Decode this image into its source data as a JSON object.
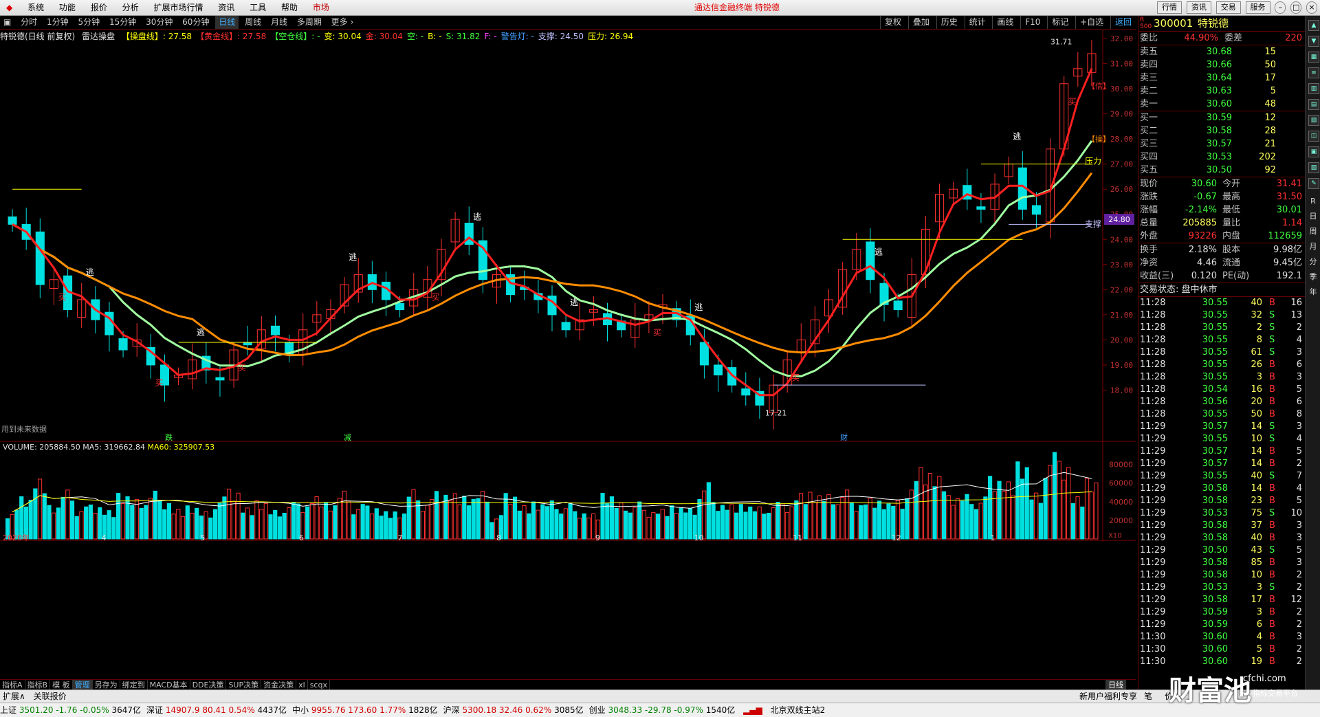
{
  "menu": {
    "items": [
      "系统",
      "功能",
      "报价",
      "分析",
      "扩展市场行情",
      "资讯",
      "工具",
      "帮助",
      "市场"
    ],
    "title": "通达信金融终端  特锐德",
    "right_buttons": [
      "行情",
      "资讯",
      "交易",
      "服务"
    ]
  },
  "period_bar": {
    "items": [
      "分时",
      "1分钟",
      "5分钟",
      "15分钟",
      "30分钟",
      "60分钟",
      "日线",
      "周线",
      "月线",
      "多周期",
      "更多 ›"
    ],
    "active": "日线",
    "right_tools": [
      "复权",
      "叠加",
      "历史",
      "统计",
      "画线",
      "F10",
      "标记",
      "+自选",
      "返回"
    ]
  },
  "indicator_line": {
    "stock": "特锐德(日线 前复权)",
    "name": "雷达操盘",
    "items": [
      {
        "label": "【操盘线】: 27.58",
        "color": "#ffff00"
      },
      {
        "label": "【黄金线】: 27.58",
        "color": "#ff3030"
      },
      {
        "label": "【空仓线】: -",
        "color": "#40ff40"
      },
      {
        "label": "变: 30.04",
        "color": "#ffff00"
      },
      {
        "label": "金: 30.04",
        "color": "#ff3030"
      },
      {
        "label": "空: -",
        "color": "#40ff40"
      },
      {
        "label": "B: -",
        "color": "#ffff00"
      },
      {
        "label": "S: 31.82",
        "color": "#40ff40"
      },
      {
        "label": "F: -",
        "color": "#ff40ff"
      },
      {
        "label": "警告灯: -",
        "color": "#40a0ff"
      },
      {
        "label": "支撑: 24.50",
        "color": "#c0c0ff"
      },
      {
        "label": "压力: 26.94",
        "color": "#ffff00"
      }
    ]
  },
  "chart_data": {
    "type": "candlestick",
    "title": "特锐德(日线 前复权)",
    "y_ticks": [
      "32.00",
      "31.00",
      "30.00",
      "29.00",
      "28.00",
      "27.00",
      "26.00",
      "25.00",
      "24.00",
      "23.00",
      "22.00",
      "21.00",
      "20.00",
      "19.00",
      "18.00"
    ],
    "price_range": [
      17.21,
      31.71
    ],
    "high_label": "31.71",
    "low_label": "17.21",
    "current_price_tag": "24.80",
    "month_labels": [
      "2020年",
      "4",
      "5",
      "6",
      "7",
      "8",
      "9",
      "10",
      "11",
      "12",
      "1"
    ],
    "bottom_markers": [
      "跌",
      "减",
      "财"
    ],
    "left_note": "用到未来数据",
    "signal_labels": {
      "buy": "买",
      "escape": "逃"
    },
    "side_labels": [
      "【信】",
      "【操】",
      "压力",
      "支撑"
    ],
    "volume": {
      "header": "VOLUME: 205884.50",
      "ma5": "MA5: 319662.84",
      "ma60": "MA60: 325907.53",
      "y_ticks": [
        "80000",
        "60000",
        "40000",
        "20000"
      ],
      "unit": "X10"
    },
    "close_series": [
      24.6,
      24.0,
      22.2,
      22.4,
      21.2,
      21.6,
      20.8,
      20.2,
      19.6,
      20.0,
      19.0,
      18.2,
      18.6,
      19.2,
      18.8,
      18.4,
      19.6,
      19.8,
      20.4,
      20.2,
      19.4,
      20.4,
      21.0,
      21.2,
      22.2,
      22.6,
      22.0,
      21.6,
      21.2,
      22.0,
      22.4,
      23.6,
      24.8,
      23.8,
      22.4,
      22.6,
      21.8,
      22.0,
      21.6,
      21.0,
      20.4,
      20.8,
      21.2,
      20.6,
      20.4,
      20.8,
      21.0,
      21.4,
      20.8,
      20.2,
      19.0,
      18.6,
      18.2,
      17.8,
      17.4,
      18.2,
      19.2,
      20.0,
      20.8,
      21.6,
      22.8,
      23.6,
      22.4,
      21.4,
      21.2,
      22.6,
      24.4,
      25.8,
      26.0,
      25.6,
      25.2,
      26.2,
      27.0,
      25.2,
      25.0,
      27.6,
      30.2,
      30.8,
      31.4
    ]
  },
  "quote": {
    "code": "300001",
    "name": "特锐德",
    "weibi": {
      "l1": "委比",
      "v1": "44.90%",
      "l2": "委差",
      "v2": "220"
    },
    "sells": [
      {
        "label": "卖五",
        "price": "30.68",
        "vol": "15"
      },
      {
        "label": "卖四",
        "price": "30.66",
        "vol": "50"
      },
      {
        "label": "卖三",
        "price": "30.64",
        "vol": "17"
      },
      {
        "label": "卖二",
        "price": "30.63",
        "vol": "5"
      },
      {
        "label": "卖一",
        "price": "30.60",
        "vol": "48"
      }
    ],
    "buys": [
      {
        "label": "买一",
        "price": "30.59",
        "vol": "12"
      },
      {
        "label": "买二",
        "price": "30.58",
        "vol": "28"
      },
      {
        "label": "买三",
        "price": "30.57",
        "vol": "21"
      },
      {
        "label": "买四",
        "price": "30.53",
        "vol": "202"
      },
      {
        "label": "买五",
        "price": "30.50",
        "vol": "92"
      }
    ],
    "stats": [
      {
        "l1": "现价",
        "v1": "30.60",
        "l2": "今开",
        "v2": "31.41",
        "c1": "#40ff40",
        "c2": "#ff3030"
      },
      {
        "l1": "涨跌",
        "v1": "-0.67",
        "l2": "最高",
        "v2": "31.50",
        "c1": "#40ff40",
        "c2": "#ff3030"
      },
      {
        "l1": "涨幅",
        "v1": "-2.14%",
        "l2": "最低",
        "v2": "30.01",
        "c1": "#40ff40",
        "c2": "#40ff40"
      },
      {
        "l1": "总量",
        "v1": "205885",
        "l2": "量比",
        "v2": "1.14",
        "c1": "#ffff60",
        "c2": "#ff3030"
      },
      {
        "l1": "外盘",
        "v1": "93226",
        "l2": "内盘",
        "v2": "112659",
        "c1": "#ff3030",
        "c2": "#40ff40"
      }
    ],
    "stats2": [
      {
        "l1": "换手",
        "v1": "2.18%",
        "l2": "股本",
        "v2": "9.98亿"
      },
      {
        "l1": "净资",
        "v1": "4.46",
        "l2": "流通",
        "v2": "9.45亿"
      },
      {
        "l1": "收益(三)",
        "v1": "0.120",
        "l2": "PE(动)",
        "v2": "192.1"
      }
    ],
    "trade_status": "交易状态: 盘中休市",
    "ticks": [
      {
        "t": "11:28",
        "p": "30.55",
        "v": "40",
        "d": "B",
        "n": "16"
      },
      {
        "t": "11:28",
        "p": "30.55",
        "v": "32",
        "d": "S",
        "n": "13"
      },
      {
        "t": "11:28",
        "p": "30.55",
        "v": "2",
        "d": "S",
        "n": "2"
      },
      {
        "t": "11:28",
        "p": "30.55",
        "v": "8",
        "d": "S",
        "n": "4"
      },
      {
        "t": "11:28",
        "p": "30.55",
        "v": "61",
        "d": "S",
        "n": "3"
      },
      {
        "t": "11:28",
        "p": "30.55",
        "v": "26",
        "d": "B",
        "n": "6"
      },
      {
        "t": "11:28",
        "p": "30.55",
        "v": "3",
        "d": "B",
        "n": "3"
      },
      {
        "t": "11:28",
        "p": "30.54",
        "v": "16",
        "d": "B",
        "n": "5"
      },
      {
        "t": "11:28",
        "p": "30.56",
        "v": "20",
        "d": "B",
        "n": "6"
      },
      {
        "t": "11:28",
        "p": "30.55",
        "v": "50",
        "d": "B",
        "n": "8"
      },
      {
        "t": "11:29",
        "p": "30.57",
        "v": "14",
        "d": "S",
        "n": "3"
      },
      {
        "t": "11:29",
        "p": "30.55",
        "v": "10",
        "d": "S",
        "n": "4"
      },
      {
        "t": "11:29",
        "p": "30.57",
        "v": "14",
        "d": "B",
        "n": "5"
      },
      {
        "t": "11:29",
        "p": "30.57",
        "v": "14",
        "d": "B",
        "n": "2"
      },
      {
        "t": "11:29",
        "p": "30.55",
        "v": "40",
        "d": "S",
        "n": "7"
      },
      {
        "t": "11:29",
        "p": "30.58",
        "v": "14",
        "d": "B",
        "n": "4"
      },
      {
        "t": "11:29",
        "p": "30.58",
        "v": "23",
        "d": "B",
        "n": "5"
      },
      {
        "t": "11:29",
        "p": "30.53",
        "v": "75",
        "d": "S",
        "n": "10"
      },
      {
        "t": "11:29",
        "p": "30.58",
        "v": "37",
        "d": "B",
        "n": "3"
      },
      {
        "t": "11:29",
        "p": "30.58",
        "v": "40",
        "d": "B",
        "n": "3"
      },
      {
        "t": "11:29",
        "p": "30.50",
        "v": "43",
        "d": "S",
        "n": "5"
      },
      {
        "t": "11:29",
        "p": "30.58",
        "v": "85",
        "d": "B",
        "n": "3"
      },
      {
        "t": "11:29",
        "p": "30.58",
        "v": "10",
        "d": "B",
        "n": "2"
      },
      {
        "t": "11:29",
        "p": "30.53",
        "v": "3",
        "d": "S",
        "n": "2"
      },
      {
        "t": "11:29",
        "p": "30.58",
        "v": "17",
        "d": "B",
        "n": "12"
      },
      {
        "t": "11:29",
        "p": "30.59",
        "v": "3",
        "d": "B",
        "n": "2"
      },
      {
        "t": "11:29",
        "p": "30.59",
        "v": "6",
        "d": "B",
        "n": "2"
      },
      {
        "t": "11:30",
        "p": "30.60",
        "v": "4",
        "d": "B",
        "n": "3"
      },
      {
        "t": "11:30",
        "p": "30.60",
        "v": "5",
        "d": "B",
        "n": "2"
      },
      {
        "t": "11:30",
        "p": "30.60",
        "v": "19",
        "d": "B",
        "n": "2"
      }
    ],
    "side_icons": [
      "R",
      "日",
      "周",
      "月",
      "分",
      "季",
      "年"
    ]
  },
  "tabs": {
    "items": [
      "指标A",
      "指标B",
      "模 板",
      "管理",
      "另存为",
      "绑定到",
      "MACD基本",
      "DDE决策",
      "SUP决策",
      "资金决策",
      "xl",
      "scqx"
    ],
    "active": "管理",
    "period_label": "日线"
  },
  "subbar": {
    "left1": "扩展∧",
    "left2": "关联报价",
    "right1": "新用户福利专享",
    "right2": "笔",
    "right3": "价"
  },
  "status": {
    "indices": [
      {
        "name": "上证",
        "val": "3501.20",
        "chg": "-1.76",
        "pct": "-0.05%",
        "amt": "3647亿",
        "dir": "dn"
      },
      {
        "name": "深证",
        "val": "14907.9",
        "chg": "80.41",
        "pct": "0.54%",
        "amt": "4437亿",
        "dir": "up"
      },
      {
        "name": "中小",
        "val": "9955.76",
        "chg": "173.60",
        "pct": "1.77%",
        "amt": "1828亿",
        "dir": "up"
      },
      {
        "name": "沪深",
        "val": "5300.18",
        "chg": "32.46",
        "pct": "0.62%",
        "amt": "3085亿",
        "dir": "up"
      },
      {
        "name": "创业",
        "val": "3048.33",
        "chg": "-29.78",
        "pct": "-0.97%",
        "amt": "1540亿",
        "dir": "dn"
      }
    ],
    "server": "北京双线主站2"
  },
  "watermark": {
    "big": "财富池",
    "site": "cfchi.com",
    "sub": "指标交易平台"
  }
}
